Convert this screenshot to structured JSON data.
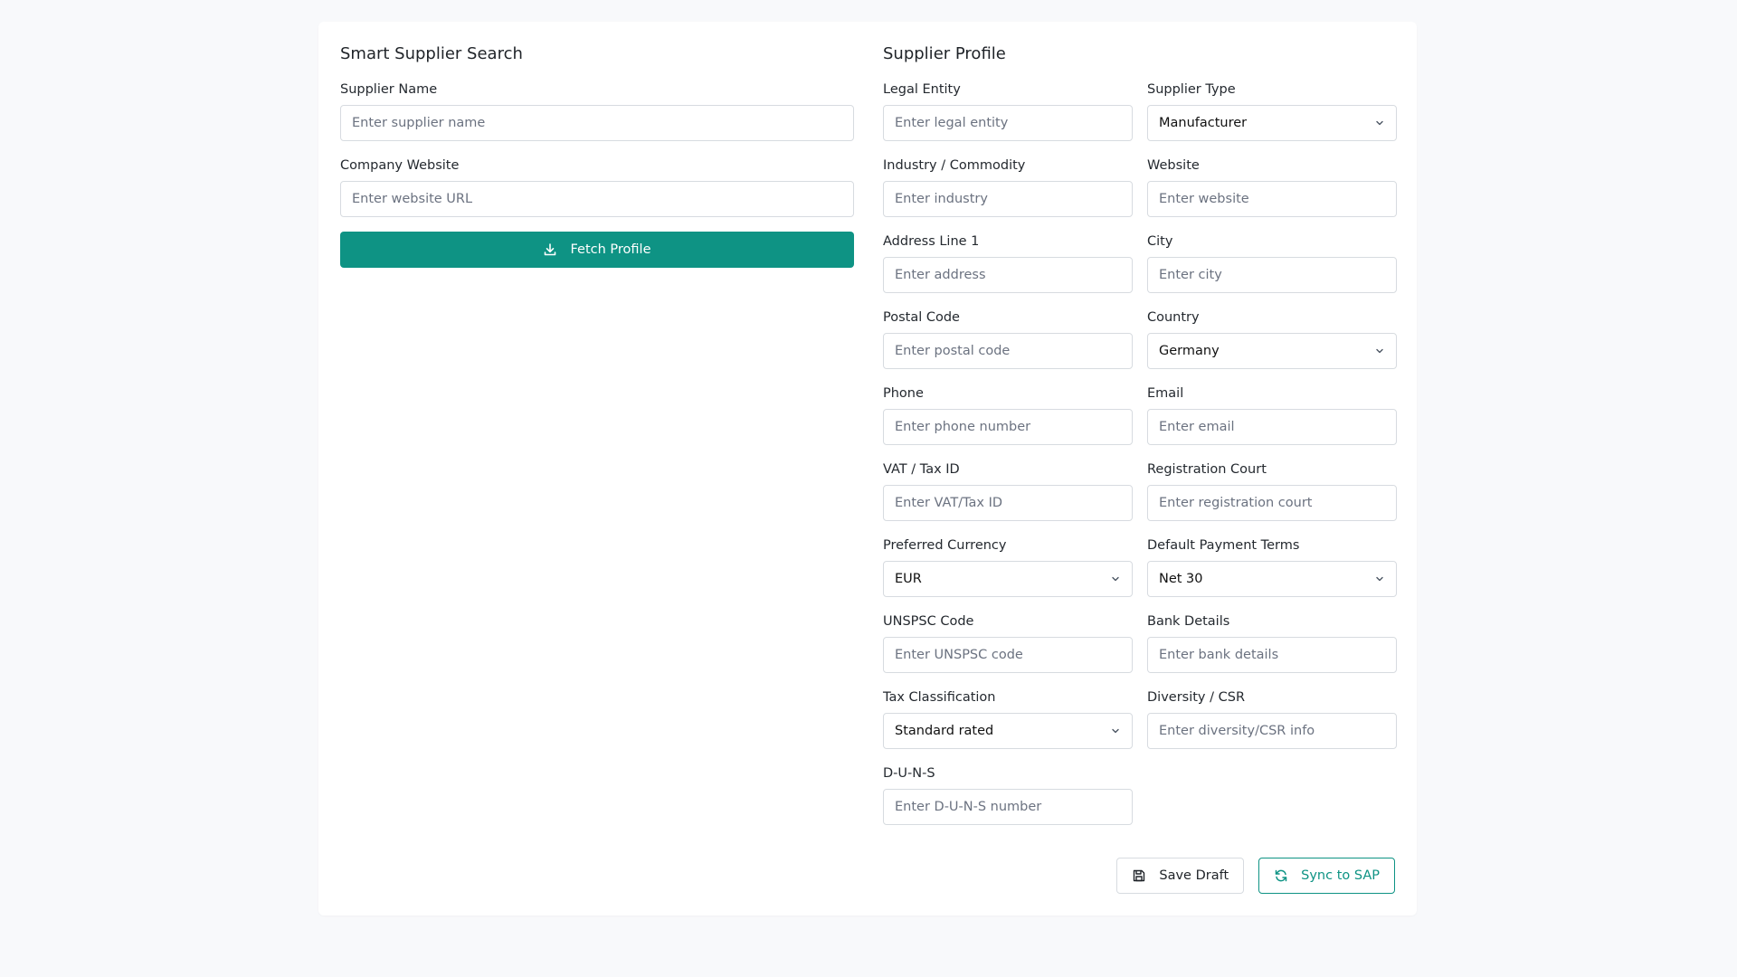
{
  "search": {
    "title": "Smart Supplier Search",
    "supplier_name_label": "Supplier Name",
    "supplier_name_placeholder": "Enter supplier name",
    "website_label": "Company Website",
    "website_placeholder": "Enter website URL",
    "fetch_label": "Fetch Profile"
  },
  "profile": {
    "title": "Supplier Profile",
    "legal_entity_label": "Legal Entity",
    "legal_entity_placeholder": "Enter legal entity",
    "supplier_type_label": "Supplier Type",
    "supplier_type_value": "Manufacturer",
    "industry_label": "Industry / Commodity",
    "industry_placeholder": "Enter industry",
    "website_label": "Website",
    "website_placeholder": "Enter website",
    "address_label": "Address Line 1",
    "address_placeholder": "Enter address",
    "city_label": "City",
    "city_placeholder": "Enter city",
    "postal_label": "Postal Code",
    "postal_placeholder": "Enter postal code",
    "country_label": "Country",
    "country_value": "Germany",
    "phone_label": "Phone",
    "phone_placeholder": "Enter phone number",
    "email_label": "Email",
    "email_placeholder": "Enter email",
    "vat_label": "VAT / Tax ID",
    "vat_placeholder": "Enter VAT/Tax ID",
    "court_label": "Registration Court",
    "court_placeholder": "Enter registration court",
    "currency_label": "Preferred Currency",
    "currency_value": "EUR",
    "payment_label": "Default Payment Terms",
    "payment_value": "Net 30",
    "unspsc_label": "UNSPSC Code",
    "unspsc_placeholder": "Enter UNSPSC code",
    "bank_label": "Bank Details",
    "bank_placeholder": "Enter bank details",
    "taxclass_label": "Tax Classification",
    "taxclass_value": "Standard rated",
    "diversity_label": "Diversity / CSR",
    "diversity_placeholder": "Enter diversity/CSR info",
    "duns_label": "D-U-N-S",
    "duns_placeholder": "Enter D-U-N-S number"
  },
  "actions": {
    "save_label": "Save Draft",
    "sync_label": "Sync to SAP"
  },
  "colors": {
    "accent": "#0e9384",
    "background": "#f8f9fb",
    "border": "#d7dbe0"
  }
}
